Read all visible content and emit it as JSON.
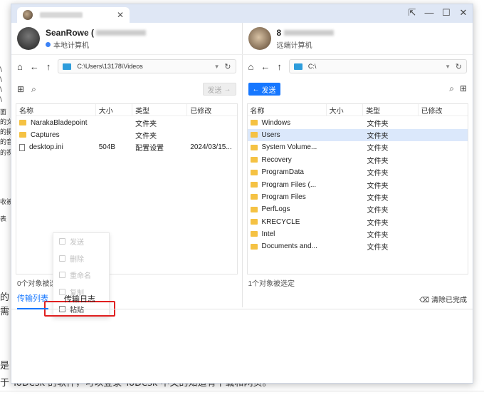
{
  "background": {
    "left_fragments": [
      "\\",
      "\\",
      "\\",
      "\\",
      "面",
      "的文",
      "的摄",
      "的音",
      "的视",
      "收被",
      "表",
      "的",
      "需",
      "是",
      "于"
    ],
    "bottom_line": "于 ToDesk 的软件，可以登录 ToDesk 中文的知道有下载和网页。"
  },
  "window": {
    "close_tab": "✕",
    "controls": {
      "pin": "⇱",
      "minimize": "—",
      "maximize": "☐",
      "close": "✕"
    }
  },
  "local": {
    "name": "SeanRowe (",
    "sub": "本地计算机",
    "path": "C:\\Users\\13178\\Videos",
    "send": "发送",
    "columns": [
      "名称",
      "大小",
      "类型",
      "已修改"
    ],
    "files": [
      {
        "name": "NarakaBladepoint",
        "size": "",
        "type": "文件夹",
        "modified": "",
        "icon": "folder-icon"
      },
      {
        "name": "Captures",
        "size": "",
        "type": "文件夹",
        "modified": "",
        "icon": "folder-icon"
      },
      {
        "name": "desktop.ini",
        "size": "504B",
        "type": "配置设置",
        "modified": "2024/03/15...",
        "icon": "file-icon"
      }
    ],
    "status": "0个对象被选定"
  },
  "remote": {
    "name": "8",
    "sub": "远端计算机",
    "path": "C:\\",
    "send": "发送",
    "columns": [
      "名称",
      "大小",
      "类型",
      "已修改"
    ],
    "files": [
      {
        "name": "Windows",
        "type": "文件夹"
      },
      {
        "name": "Users",
        "type": "文件夹"
      },
      {
        "name": "System Volume...",
        "type": "文件夹"
      },
      {
        "name": "Recovery",
        "type": "文件夹"
      },
      {
        "name": "ProgramData",
        "type": "文件夹"
      },
      {
        "name": "Program Files (...",
        "type": "文件夹"
      },
      {
        "name": "Program Files",
        "type": "文件夹"
      },
      {
        "name": "PerfLogs",
        "type": "文件夹"
      },
      {
        "name": "KRECYCLE",
        "type": "文件夹"
      },
      {
        "name": "Intel",
        "type": "文件夹"
      },
      {
        "name": "Documents and...",
        "type": "文件夹"
      }
    ],
    "selected_index": 1,
    "status": "1个对象被选定"
  },
  "context_menu": {
    "items": [
      {
        "label": "发送",
        "enabled": false
      },
      {
        "label": "删除",
        "enabled": false
      },
      {
        "label": "重命名",
        "enabled": false
      },
      {
        "label": "复制",
        "enabled": false
      },
      {
        "label": "粘贴",
        "enabled": true
      }
    ]
  },
  "transfer": {
    "tabs": [
      "传输列表",
      "传输日志"
    ],
    "active_tab": 0,
    "clear": "清除已完成"
  },
  "colors": {
    "accent": "#1677ff",
    "highlight_box": "#e02020",
    "folder": "#f5c243"
  }
}
